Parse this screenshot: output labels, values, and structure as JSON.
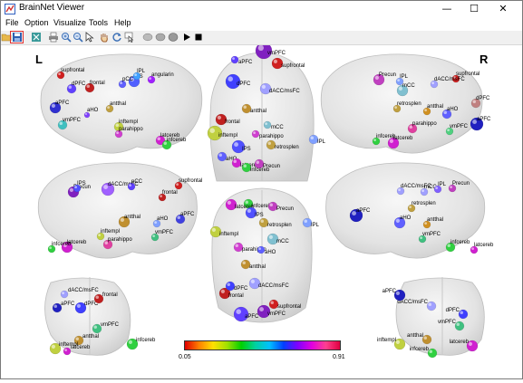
{
  "window": {
    "title": "BrainNet Viewer",
    "minimize_symbol": "—",
    "maximize_symbol": "☐",
    "close_symbol": "✕"
  },
  "menu": [
    "File",
    "Option",
    "Visualize",
    "Tools",
    "Help"
  ],
  "toolbar": {
    "buttons": [
      {
        "name": "open-icon",
        "color": "#e8b84a"
      },
      {
        "name": "save-icon",
        "color": "#2d5fb0"
      },
      {
        "name": "print-preview-icon",
        "color": "#3a9a9a"
      },
      {
        "name": "print-icon",
        "color": "#666666"
      },
      {
        "name": "zoom-in-icon",
        "color": "#3b6fb6"
      },
      {
        "name": "zoom-out-icon",
        "color": "#3b6fb6"
      },
      {
        "name": "select-icon",
        "color": "#555555"
      },
      {
        "name": "pan-icon",
        "color": "#c08040"
      },
      {
        "name": "rotate-icon",
        "color": "#3b6fb6"
      },
      {
        "name": "data-cursor-icon",
        "color": "#666666"
      },
      {
        "name": "brain-lateral-icon",
        "color": "#999999"
      },
      {
        "name": "brain-medial-icon",
        "color": "#999999"
      },
      {
        "name": "brain-full-icon",
        "color": "#999999"
      },
      {
        "name": "play-icon",
        "color": "#000000"
      },
      {
        "name": "stop-icon",
        "color": "#000000"
      }
    ]
  },
  "labels": {
    "left": "L",
    "right": "R"
  },
  "colorbar": {
    "min": "0.05",
    "max": "0.91"
  },
  "views": {
    "left_lateral": {
      "nodes": [
        {
          "label": "supfrontal",
          "color": "#d02020"
        },
        {
          "label": "IPS",
          "color": "#5060ff"
        },
        {
          "label": "angularin",
          "color": "#a020ff"
        },
        {
          "label": "dPFC",
          "color": "#6040ff"
        },
        {
          "label": "frontal",
          "color": "#c02020"
        },
        {
          "label": "pCC",
          "color": "#6060ff"
        },
        {
          "label": "IPL",
          "color": "#40a0ff"
        },
        {
          "label": "aPFC",
          "color": "#3030d0"
        },
        {
          "label": "vmPFC",
          "color": "#40c0c0"
        },
        {
          "label": "antthal",
          "color": "#c0a040"
        },
        {
          "label": "aHO",
          "color": "#8040ff"
        },
        {
          "label": "inftempl",
          "color": "#c0d040"
        },
        {
          "label": "parahippo",
          "color": "#d040d0"
        },
        {
          "label": "latcereb",
          "color": "#d020d0"
        },
        {
          "label": "infcereb",
          "color": "#30d040"
        }
      ]
    },
    "right_lateral": {
      "nodes": [
        {
          "label": "Precun",
          "color": "#c040c0"
        },
        {
          "label": "IPL",
          "color": "#80a0ff"
        },
        {
          "label": "supfrontal",
          "color": "#d02020"
        },
        {
          "label": "dACC/msFC",
          "color": "#a0a0ff"
        },
        {
          "label": "mCC",
          "color": "#80c0d0"
        },
        {
          "label": "dPFC",
          "color": "#c08080"
        },
        {
          "label": "retrosplen",
          "color": "#c0a040"
        },
        {
          "label": "antthal",
          "color": "#d09020"
        },
        {
          "label": "aHO",
          "color": "#6060ff"
        },
        {
          "label": "aPFC",
          "color": "#2020c0"
        },
        {
          "label": "parahippo",
          "color": "#e040a0"
        },
        {
          "label": "infcereb",
          "color": "#30d040"
        },
        {
          "label": "latcereb",
          "color": "#d020d0"
        },
        {
          "label": "vmPFC",
          "color": "#50d080"
        }
      ]
    },
    "left_medial": {
      "nodes": [
        {
          "label": "Precun",
          "color": "#8020c0"
        },
        {
          "label": "IPS",
          "color": "#5050ff"
        },
        {
          "label": "dACC/msFC",
          "color": "#a060ff"
        },
        {
          "label": "pCC",
          "color": "#6040ff"
        },
        {
          "label": "supfrontal",
          "color": "#d02020"
        },
        {
          "label": "frontal",
          "color": "#c02020"
        },
        {
          "label": "aPFC",
          "color": "#4040e0"
        },
        {
          "label": "antthal",
          "color": "#c09030"
        },
        {
          "label": "aHO",
          "color": "#80a0ff"
        },
        {
          "label": "vmPFC",
          "color": "#40c080"
        },
        {
          "label": "inftempl",
          "color": "#c0d040"
        },
        {
          "label": "parahippo",
          "color": "#e040a0"
        },
        {
          "label": "latcereb",
          "color": "#d020d0"
        },
        {
          "label": "infcereb",
          "color": "#30d040"
        }
      ]
    },
    "right_medial": {
      "nodes": [
        {
          "label": "mCC",
          "color": "#a0a0ff"
        },
        {
          "label": "IPL",
          "color": "#8060ff"
        },
        {
          "label": "Precun",
          "color": "#c040c0"
        },
        {
          "label": "dACC/msFC",
          "color": "#a0a0ff"
        },
        {
          "label": "aPFC",
          "color": "#2020c0"
        },
        {
          "label": "retrosplen",
          "color": "#c0a040"
        },
        {
          "label": "aHO",
          "color": "#6060ff"
        },
        {
          "label": "antthal",
          "color": "#d09020"
        },
        {
          "label": "infcereb",
          "color": "#30d040"
        },
        {
          "label": "vmPFC",
          "color": "#40c080"
        },
        {
          "label": "latcereb",
          "color": "#d020d0"
        }
      ]
    },
    "dorsal": {
      "nodes": [
        {
          "label": "aPFC",
          "color": "#6040ff"
        },
        {
          "label": "vmPFC",
          "color": "#8020c0"
        },
        {
          "label": "supfrontal",
          "color": "#d02020"
        },
        {
          "label": "dPFC",
          "color": "#4040ff"
        },
        {
          "label": "frontal",
          "color": "#c02020"
        },
        {
          "label": "dACC/msFC",
          "color": "#a0a0ff"
        },
        {
          "label": "antthal",
          "color": "#c09030"
        },
        {
          "label": "parahippo",
          "color": "#d040d0"
        },
        {
          "label": "mCC",
          "color": "#80c0d0"
        },
        {
          "label": "aHO",
          "color": "#6060ff"
        },
        {
          "label": "inftempl",
          "color": "#c0d040"
        },
        {
          "label": "IPS",
          "color": "#5050ff"
        },
        {
          "label": "retrosplen",
          "color": "#c0a040"
        },
        {
          "label": "IPL",
          "color": "#80a0ff"
        },
        {
          "label": "latcereb",
          "color": "#d020d0"
        },
        {
          "label": "Precun",
          "color": "#c040c0"
        },
        {
          "label": "infcereb",
          "color": "#30d040"
        }
      ]
    },
    "ventral": {
      "nodes": [
        {
          "label": "infcereb",
          "color": "#30d040"
        },
        {
          "label": "latcereb",
          "color": "#d020d0"
        },
        {
          "label": "IPS",
          "color": "#5050ff"
        },
        {
          "label": "Precun",
          "color": "#c040c0"
        },
        {
          "label": "IPL",
          "color": "#80a0ff"
        },
        {
          "label": "inftempl",
          "color": "#c0d040"
        },
        {
          "label": "retrosplen",
          "color": "#c0a040"
        },
        {
          "label": "parahippo",
          "color": "#d040d0"
        },
        {
          "label": "aHO",
          "color": "#6060ff"
        },
        {
          "label": "mCC",
          "color": "#80c0d0"
        },
        {
          "label": "antthal",
          "color": "#c09030"
        },
        {
          "label": "frontal",
          "color": "#c02020"
        },
        {
          "label": "dACC/msFC",
          "color": "#a0a0ff"
        },
        {
          "label": "dPFC",
          "color": "#4040ff"
        },
        {
          "label": "aPFC",
          "color": "#6040ff"
        },
        {
          "label": "supfrontal",
          "color": "#d02020"
        },
        {
          "label": "vmPFC",
          "color": "#8020c0"
        }
      ]
    },
    "anterior": {
      "nodes": [
        {
          "label": "dACC/msFC",
          "color": "#a0a0ff"
        },
        {
          "label": "aPFC",
          "color": "#2020c0"
        },
        {
          "label": "dPFC",
          "color": "#4040ff"
        },
        {
          "label": "frontal",
          "color": "#c02020"
        },
        {
          "label": "vmPFC",
          "color": "#40c080"
        },
        {
          "label": "antthal",
          "color": "#c09030"
        },
        {
          "label": "inftempl",
          "color": "#c0d040"
        },
        {
          "label": "latcereb",
          "color": "#d020d0"
        },
        {
          "label": "infcereb",
          "color": "#30d040"
        }
      ]
    },
    "posterior": {
      "nodes": [
        {
          "label": "dPFC",
          "color": "#4040ff"
        },
        {
          "label": "dACC/msFC",
          "color": "#a0a0ff"
        },
        {
          "label": "aPFC",
          "color": "#2020c0"
        },
        {
          "label": "antthal",
          "color": "#c09030"
        },
        {
          "label": "vmPFC",
          "color": "#40c080"
        },
        {
          "label": "inftempl",
          "color": "#c0d040"
        },
        {
          "label": "latcereb",
          "color": "#d020d0"
        },
        {
          "label": "infcereb",
          "color": "#30d040"
        }
      ]
    }
  }
}
